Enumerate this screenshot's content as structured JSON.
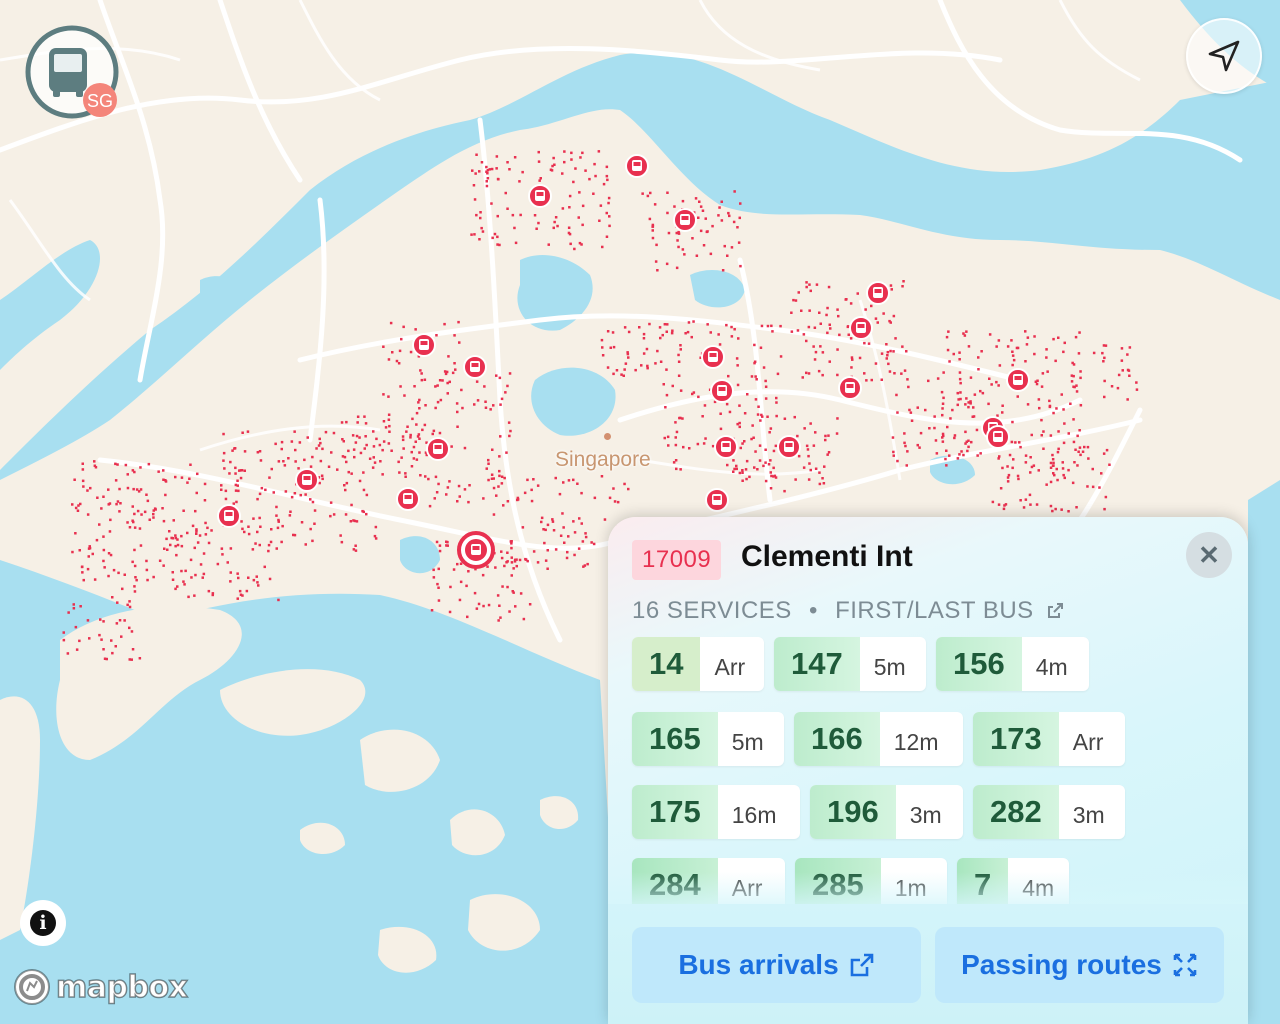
{
  "map": {
    "city_label": "Singapore",
    "colors": {
      "land": "#f6f0e6",
      "water": "#a8dff0",
      "road": "#ffffff",
      "stop_dot": "#e8304f"
    }
  },
  "app_logo": {
    "badge": "SG",
    "icon": "bus-icon"
  },
  "locate_button": {
    "icon": "location-arrow-icon"
  },
  "attribution": {
    "info_glyph": "i",
    "brand": "mapbox"
  },
  "stop": {
    "code": "17009",
    "name": "Clementi Int",
    "services_count": "16 SERVICES",
    "separator": "•",
    "first_last_label": "FIRST/LAST BUS",
    "close_glyph": "✕",
    "services": [
      {
        "number": "14",
        "eta": "Arr"
      },
      {
        "number": "147",
        "eta": "5m"
      },
      {
        "number": "156",
        "eta": "4m"
      },
      {
        "number": "165",
        "eta": "5m"
      },
      {
        "number": "166",
        "eta": "12m"
      },
      {
        "number": "173",
        "eta": "Arr"
      },
      {
        "number": "175",
        "eta": "16m"
      },
      {
        "number": "196",
        "eta": "3m"
      },
      {
        "number": "282",
        "eta": "3m"
      },
      {
        "number": "284",
        "eta": "Arr"
      },
      {
        "number": "285",
        "eta": "1m"
      },
      {
        "number": "7",
        "eta": "4m"
      }
    ],
    "actions": {
      "bus_arrivals": "Bus arrivals",
      "passing_routes": "Passing routes"
    }
  }
}
